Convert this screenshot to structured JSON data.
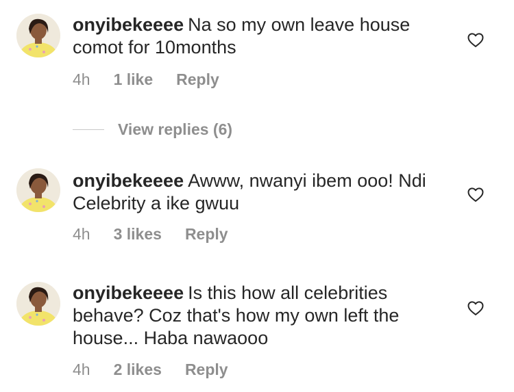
{
  "comments": [
    {
      "username": "onyibekeeee",
      "text": "Na so my own leave house comot for 10months",
      "time": "4h",
      "likes": "1 like",
      "reply": "Reply",
      "icons": {
        "avatar": "avatar-photo",
        "like": "heart-outline-icon"
      }
    },
    {
      "username": "onyibekeeee",
      "text": "Awww, nwanyi ibem ooo! Ndi Celebrity a ike gwuu",
      "time": "4h",
      "likes": "3 likes",
      "reply": "Reply",
      "icons": {
        "avatar": "avatar-photo",
        "like": "heart-outline-icon"
      }
    },
    {
      "username": "onyibekeeee",
      "text": "Is this how all celebrities behave? Coz that's how my own left the house... Haba nawaooo",
      "time": "4h",
      "likes": "2 likes",
      "reply": "Reply",
      "icons": {
        "avatar": "avatar-photo",
        "like": "heart-outline-icon"
      }
    }
  ],
  "view_replies": {
    "label": "View replies (6)"
  },
  "colors": {
    "text": "#262626",
    "secondary": "#8e8e8e",
    "divider": "#c7c7c7"
  }
}
